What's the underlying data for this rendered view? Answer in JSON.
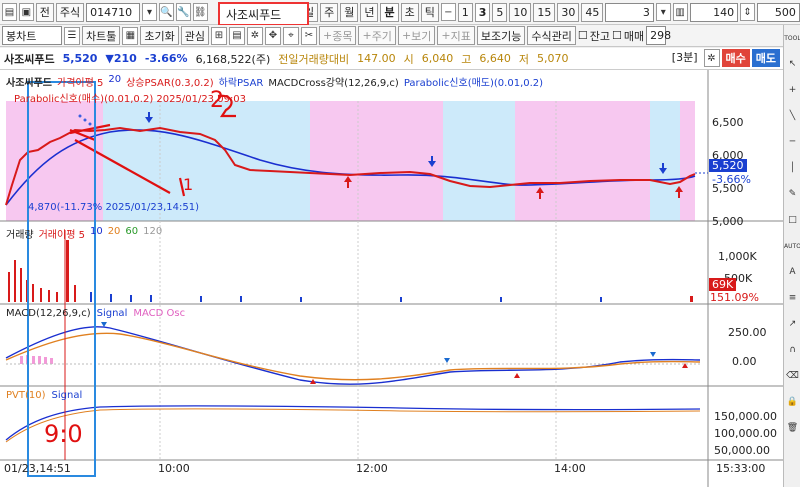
{
  "toolbar1": {
    "tab_jeon": "전",
    "tab_stock": "주식",
    "code": "014710",
    "name": "사조씨푸드",
    "periods": [
      "일",
      "주",
      "월",
      "년",
      "분",
      "초",
      "틱"
    ],
    "active_period": "분",
    "intervals": [
      "1",
      "3",
      "5",
      "10",
      "15",
      "30",
      "45"
    ],
    "active_interval": "3",
    "dropdown_value": "3",
    "count_value": "140",
    "zoom_value": "500"
  },
  "toolbar2": {
    "chart_type": "봉차트",
    "chart_tool": "차트툴",
    "reset": "초기화",
    "watch": "관심",
    "items_label": "종목",
    "cycle_label": "주기",
    "view_label": "보기",
    "indicator_label": "지표",
    "aux_label": "보조기능",
    "formula_label": "수식관리",
    "janko": "잔고",
    "maemae": "매매",
    "right_num": "298"
  },
  "info": {
    "name": "사조씨푸드",
    "price": "5,520",
    "change": "▼210",
    "pct": "-3.66%",
    "volume": "6,168,522(주)",
    "prev_vol_label": "전일거래량대비",
    "prev_vol": "147.00",
    "open_label": "시",
    "open": "6,040",
    "high_label": "고",
    "high": "6,640",
    "low_label": "저",
    "low": "5,070",
    "interval": "[3분]",
    "buy": "매수",
    "sell": "매도"
  },
  "price_panel": {
    "legend": [
      "사조씨푸드",
      "가격이평 5",
      "20",
      "상승PSAR(0.3,0.2)",
      "하락PSAR",
      "MACDCross강약(12,26,9,c)",
      "Parabolic신호(매도)(0.01,0.2)"
    ],
    "legend2": "Parabolic신호(매수)(0.01,0.2) 2025/01/23,09:03",
    "low_note": "4,870(-11.73% 2025/01/23,14:51)",
    "axis": [
      "6,500",
      "6,000",
      "5,500",
      "5,000"
    ],
    "current": "5,520",
    "current_pct": "-3.66%",
    "annot_2": "2",
    "annot_1": "1"
  },
  "volume_panel": {
    "legend": [
      "거래량",
      "거래이평 5",
      "10",
      "20",
      "60",
      "120"
    ],
    "axis": [
      "1,000K",
      "500K"
    ],
    "current": "69K",
    "current_pct": "151.09%"
  },
  "macd_panel": {
    "legend": [
      "MACD(12,26,9,c)",
      "Signal",
      "MACD Osc"
    ],
    "axis": [
      "250.00",
      "0.00"
    ]
  },
  "pvt_panel": {
    "legend": [
      "PVT(10)",
      "Signal"
    ],
    "axis": [
      "150,000.00",
      "100,000.00",
      "50,000.00"
    ],
    "annot": "9:0"
  },
  "time_axis": {
    "labels": [
      "01/23,14:51",
      "10:00",
      "12:00",
      "14:00"
    ],
    "clock": "15:33:00"
  },
  "right_tools": [
    "TOOL",
    "AUTO"
  ]
}
